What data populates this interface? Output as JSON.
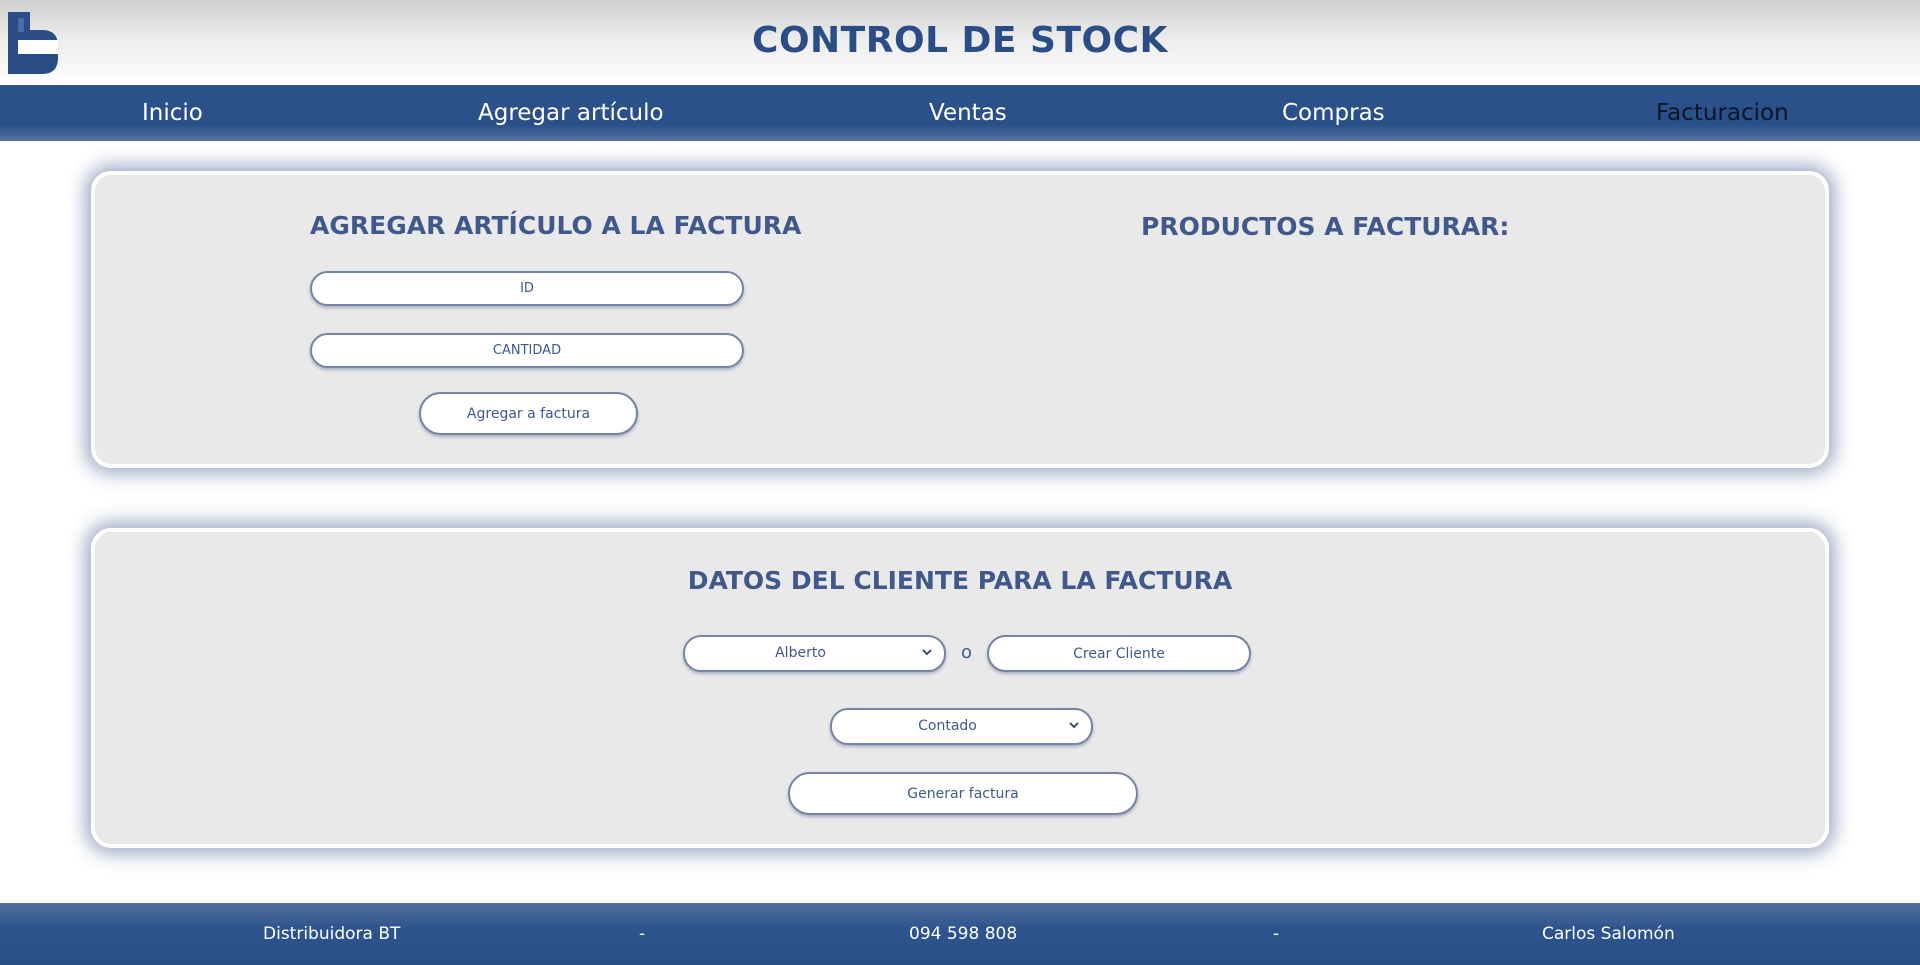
{
  "header": {
    "title": "CONTROL DE STOCK",
    "logo_icon": "bt-logo-icon"
  },
  "nav": {
    "items": [
      {
        "label": "Inicio"
      },
      {
        "label": "Agregar artículo"
      },
      {
        "label": "Ventas"
      },
      {
        "label": "Compras"
      },
      {
        "label": "Facturacion",
        "active": true
      }
    ]
  },
  "add_item_section": {
    "title": "AGREGAR ARTÍCULO A LA FACTURA",
    "id_placeholder": "ID",
    "quantity_placeholder": "CANTIDAD",
    "add_button_label": "Agregar a factura"
  },
  "products_section": {
    "title": "PRODUCTOS A FACTURAR:"
  },
  "client_section": {
    "title": "DATOS DEL CLIENTE PARA LA FACTURA",
    "client_select_value": "Alberto",
    "or_text": "o",
    "create_client_label": "Crear Cliente",
    "payment_select_value": "Contado",
    "generate_button_label": "Generar factura"
  },
  "footer": {
    "company": "Distribuidora BT",
    "separator": "-",
    "phone": "094 598 808",
    "author": "Carlos Salomón"
  },
  "colors": {
    "brand_blue": "#2a4f88",
    "card_bg": "#e9e9e9",
    "title_blue": "#40598a",
    "active_nav_text": "#0c1426"
  }
}
